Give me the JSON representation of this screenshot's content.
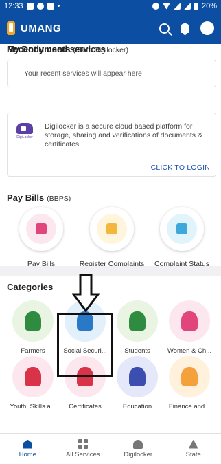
{
  "status_bar": {
    "time": "12:33",
    "battery": "20%"
  },
  "app_bar": {
    "title": "UMANG"
  },
  "recent": {
    "title": "Recently used services",
    "placeholder": "Your recent services will appear here"
  },
  "documents": {
    "title": "My Documents",
    "subtitle": "(From Digilocker)",
    "logo_label": "DigiLocker",
    "description": "Digilocker is a secure cloud based platform for storage, sharing and verifications of documents & certificates",
    "cta": "CLICK TO LOGIN"
  },
  "bills": {
    "title": "Pay Bills",
    "subtitle": "(BBPS)",
    "items": [
      {
        "label": "Pay Bills",
        "icon": "bill-icon",
        "color": "#fde7ef",
        "glyph": "#e0457b"
      },
      {
        "label": "Register Complaints",
        "icon": "complaint-form-icon",
        "color": "#fff4dc",
        "glyph": "#f4b63b"
      },
      {
        "label": "Complaint Status",
        "icon": "status-icon",
        "color": "#e1f3fb",
        "glyph": "#3ea7dc"
      }
    ]
  },
  "categories": {
    "title": "Categories",
    "items": [
      {
        "label": "Farmers",
        "icon": "farmer-icon",
        "color": "#e9f4e2",
        "glyph": "#2e8b3f"
      },
      {
        "label": "Social Securi...",
        "icon": "family-icon",
        "color": "#e2f0fb",
        "glyph": "#2a79c8"
      },
      {
        "label": "Students",
        "icon": "students-icon",
        "color": "#e9f4e2",
        "glyph": "#2e8b3f"
      },
      {
        "label": "Women & Ch...",
        "icon": "women-children-icon",
        "color": "#fde7ef",
        "glyph": "#e0457b"
      },
      {
        "label": "Youth, Skills a...",
        "icon": "youth-icon",
        "color": "#fde7ef",
        "glyph": "#d9334a"
      },
      {
        "label": "Certificates",
        "icon": "certificate-icon",
        "color": "#fde7ef",
        "glyph": "#d9334a"
      },
      {
        "label": "Education",
        "icon": "education-icon",
        "color": "#e4e8f8",
        "glyph": "#3c4fb0"
      },
      {
        "label": "Finance and...",
        "icon": "finance-icon",
        "color": "#fff1dc",
        "glyph": "#f4a03b"
      }
    ]
  },
  "bottom_nav": {
    "items": [
      {
        "label": "Home",
        "icon": "home-icon",
        "active": true
      },
      {
        "label": "All Services",
        "icon": "grid-icon",
        "active": false
      },
      {
        "label": "Digilocker",
        "icon": "digilocker-icon",
        "active": false
      },
      {
        "label": "State",
        "icon": "state-icon",
        "active": false
      }
    ]
  }
}
